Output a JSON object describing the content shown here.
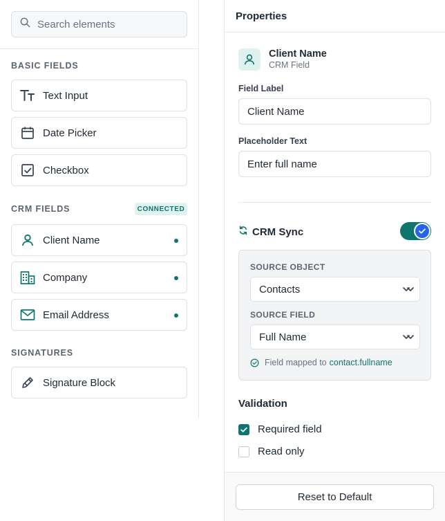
{
  "palette": {
    "search": {
      "placeholder": "Search elements",
      "value": "",
      "icon": "search-icon"
    },
    "sections": [
      {
        "title": "BASIC FIELDS",
        "items": [
          {
            "label": "Text Input",
            "icon": "text-type-icon"
          },
          {
            "label": "Date Picker",
            "icon": "calendar-icon"
          },
          {
            "label": "Checkbox",
            "icon": "checkbox-icon"
          }
        ]
      },
      {
        "title": "CRM FIELDS",
        "badge": "CONNECTED",
        "items": [
          {
            "label": "Client Name",
            "icon": "user-icon",
            "connected": true
          },
          {
            "label": "Company",
            "icon": "building-icon",
            "connected": true
          },
          {
            "label": "Email Address",
            "icon": "mail-icon",
            "connected": true
          }
        ]
      },
      {
        "title": "SIGNATURES",
        "items": [
          {
            "label": "Signature Block",
            "icon": "pen-icon"
          }
        ]
      }
    ]
  },
  "properties": {
    "title": "Properties",
    "field": {
      "name": "Client Name",
      "type": "CRM Field",
      "icon": "user-icon"
    },
    "field_label": {
      "label": "Field Label",
      "value": "Client Name"
    },
    "placeholder_text": {
      "label": "Placeholder Text",
      "value": "Enter full name"
    },
    "crm_sync": {
      "title": "CRM Sync",
      "enabled": true,
      "source_object": {
        "label": "SOURCE OBJECT",
        "value": "Contacts"
      },
      "source_field": {
        "label": "SOURCE FIELD",
        "value": "Full Name"
      },
      "mapped_text": "Field mapped to",
      "mapped_target": "contact.fullname"
    },
    "validation": {
      "title": "Validation",
      "options": [
        {
          "label": "Required field",
          "checked": true
        },
        {
          "label": "Read only",
          "checked": false
        }
      ]
    },
    "reset_label": "Reset to Default"
  },
  "colors": {
    "accent": "#0f766e",
    "accent_light": "#dff2ef",
    "toggle_knob": "#2563eb",
    "border": "#dcdfe4"
  }
}
